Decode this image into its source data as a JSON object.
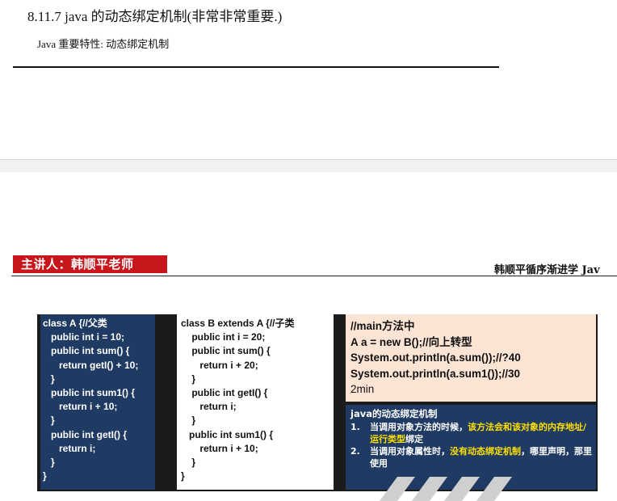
{
  "doc": {
    "heading": "8.11.7  java 的动态绑定机制(非常非常重要.)",
    "subtext": "Java 重要特性:  动态绑定机制"
  },
  "slide": {
    "lecturer": "主讲人：韩顺平老师",
    "brand": "韩顺平循序渐进学 Jav",
    "classA_code": "class A {//父类\n   public int i = 10;\n   public int sum() {\n      return getI() + 10;\n   }\n   public int sum1() {\n      return i + 10;\n   }\n   public int getI() {\n      return i;\n   }\n}",
    "classB_code": "class B extends A {//子类\n    public int i = 20;\n    public int sum() {\n       return i + 20;\n    }\n    public int getI() {\n       return i;\n    }\n   public int sum1() {\n       return i + 10;\n    }\n}",
    "main_lines": [
      "//main方法中",
      "A a = new B();//向上转型",
      "System.out.println(a.sum());//?40",
      "System.out.println(a.sum1());//30",
      "2min"
    ],
    "dynamic": {
      "title": "java的动态绑定机制",
      "item1_num": "1.",
      "item1_a": "当调用对象方法的时候，",
      "item1_b": "该方法会和该对象的内存地址/运行类型",
      "item1_c": "绑定",
      "item2_num": "2.",
      "item2_a": "当调用对象属性时，",
      "item2_b": "没有动态绑定机制",
      "item2_c": "，哪里声明，那里使用"
    }
  }
}
